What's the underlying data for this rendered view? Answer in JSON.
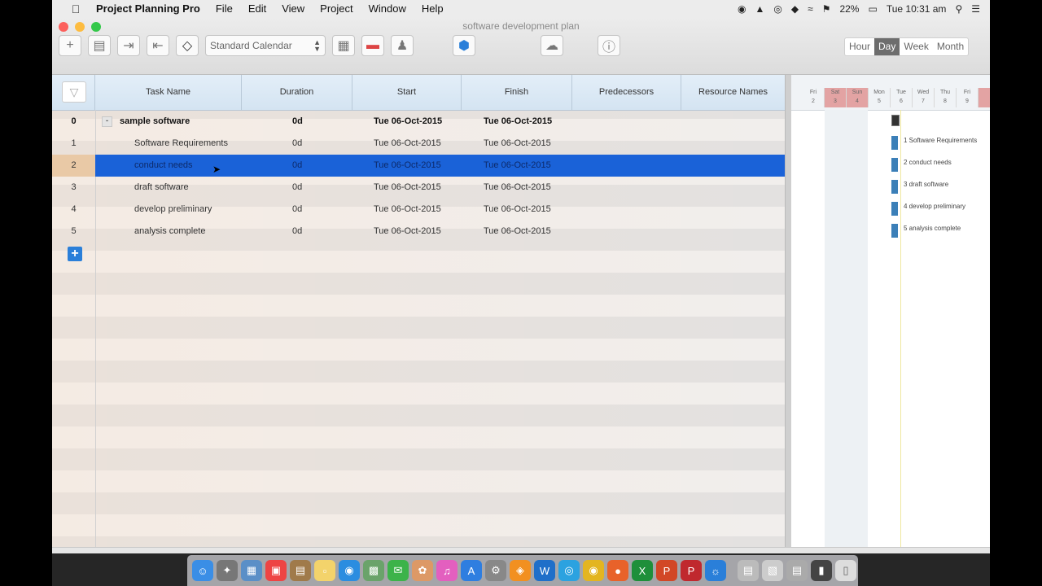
{
  "menubar": {
    "app_name": "Project Planning Pro",
    "menus": [
      "File",
      "Edit",
      "View",
      "Project",
      "Window",
      "Help"
    ],
    "battery": "22%",
    "clock": "Tue 10:31 am"
  },
  "window": {
    "title": "software development plan"
  },
  "toolbar": {
    "calendar_value": "Standard Calendar",
    "timescale": [
      "Hour",
      "Day",
      "Week",
      "Month"
    ],
    "timescale_selected": "Day"
  },
  "table": {
    "columns": [
      "Task Name",
      "Duration",
      "Start",
      "Finish",
      "Predecessors",
      "Resource Names"
    ],
    "rows": [
      {
        "id": "0",
        "name": "sample software",
        "duration": "0d",
        "start": "Tue 06-Oct-2015",
        "finish": "Tue 06-Oct-2015"
      },
      {
        "id": "1",
        "name": "Software Requirements",
        "duration": "0d",
        "start": "Tue 06-Oct-2015",
        "finish": "Tue 06-Oct-2015"
      },
      {
        "id": "2",
        "name": "conduct needs",
        "duration": "0d",
        "start": "Tue 06-Oct-2015",
        "finish": "Tue 06-Oct-2015"
      },
      {
        "id": "3",
        "name": "draft software",
        "duration": "0d",
        "start": "Tue 06-Oct-2015",
        "finish": "Tue 06-Oct-2015"
      },
      {
        "id": "4",
        "name": "develop preliminary",
        "duration": "0d",
        "start": "Tue 06-Oct-2015",
        "finish": "Tue 06-Oct-2015"
      },
      {
        "id": "5",
        "name": "analysis complete",
        "duration": "0d",
        "start": "Tue 06-Oct-2015",
        "finish": "Tue 06-Oct-2015"
      }
    ],
    "selected_row": "2"
  },
  "gantt": {
    "days": [
      {
        "d": "Fri",
        "n": "2"
      },
      {
        "d": "Sat",
        "n": "3"
      },
      {
        "d": "Sun",
        "n": "4"
      },
      {
        "d": "Mon",
        "n": "5"
      },
      {
        "d": "Tue",
        "n": "6"
      },
      {
        "d": "Wed",
        "n": "7"
      },
      {
        "d": "Thu",
        "n": "8"
      },
      {
        "d": "Fri",
        "n": "9"
      }
    ],
    "labels": [
      "1 Software Requirements",
      "2 conduct needs",
      "3 draft software",
      "4 develop preliminary",
      "5 analysis complete"
    ]
  },
  "colors": {
    "selection": "#1a62d8",
    "accent": "#2a7fd9",
    "bar": "#3b7fb8",
    "weekend": "#e3a3a3"
  }
}
